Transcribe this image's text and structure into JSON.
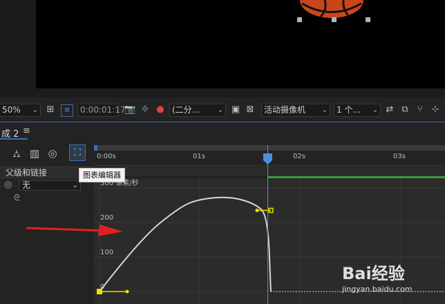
{
  "viewer": {
    "zoom": "50%",
    "timecode": "0:00:01:17",
    "resolution": "(二分...",
    "camera": "活动摄像机",
    "views": "1 个..."
  },
  "panel": {
    "tab_label": "成 2",
    "menu_icon": "hamburger-menu-icon",
    "column_header": "父级和链接",
    "parent_value": "无",
    "tooltip": "图表编辑器"
  },
  "ruler": {
    "ticks": [
      "0:00s",
      "01s",
      "02s",
      "03s"
    ]
  },
  "chart_data": {
    "type": "line",
    "xlabel": "",
    "ylabel": "像素/秒",
    "y_ticks": [
      "300 像素/秒",
      "200",
      "100",
      "0"
    ],
    "x_ticks": [
      "0:00s",
      "01s",
      "02s",
      "03s"
    ],
    "current_time_s": 1.71,
    "series": [
      {
        "values_desc": "",
        "x": [
          0,
          0.4,
          0.8,
          1.0,
          1.3,
          1.55,
          1.68,
          1.71
        ],
        "y": [
          0,
          150,
          245,
          268,
          275,
          255,
          220,
          0
        ]
      }
    ],
    "keyframes": [
      {
        "t": 0,
        "v": 0
      },
      {
        "t": 1.71,
        "v": 235
      }
    ],
    "colors": {
      "curve": "#d8d8d8",
      "playhead": "#4a90e2",
      "keyframe": "#f0e000"
    }
  },
  "watermark": {
    "brand": "Bai经验",
    "url": "jingyan.baidu.com"
  }
}
